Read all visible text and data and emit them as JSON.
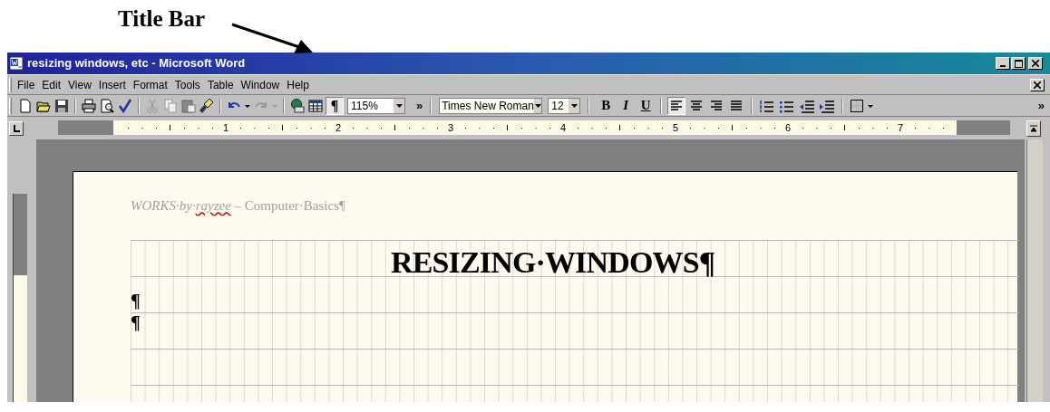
{
  "annotation": {
    "label": "Title Bar"
  },
  "window": {
    "title": "resizing windows, etc - Microsoft Word"
  },
  "menu": [
    "File",
    "Edit",
    "View",
    "Insert",
    "Format",
    "Tools",
    "Table",
    "Window",
    "Help"
  ],
  "toolbar": {
    "show_hide": {
      "label": "¶",
      "selected": true
    },
    "zoom": "115%",
    "overflow": "»",
    "font": "Times New Roman",
    "font_size": "12",
    "bold": "B",
    "italic": "I",
    "underline": "U",
    "alignment": [
      {
        "selected": true
      },
      {
        "selected": false
      },
      {
        "selected": false
      },
      {
        "selected": false
      }
    ],
    "overflow_end": "»"
  },
  "ruler": {
    "numbers": [
      "1",
      "2",
      "3",
      "4",
      "5",
      "6",
      "7"
    ]
  },
  "document": {
    "header": [
      {
        "text": "WORKS·by·",
        "italic": true,
        "misspelled": false
      },
      {
        "text": "rayzee",
        "italic": true,
        "misspelled": true
      },
      {
        "text": " – Computer·Basics¶",
        "italic": false,
        "misspelled": false
      }
    ],
    "title": "RESIZING·WINDOWS¶",
    "paragraph_marks": [
      "¶",
      "¶"
    ]
  }
}
